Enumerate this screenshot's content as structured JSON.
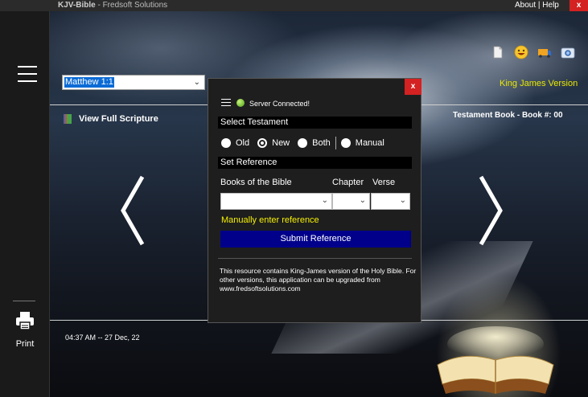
{
  "titlebar": {
    "app_name": "KJV-Bible",
    "app_sub": "- Fredsoft Solutions",
    "links": "About | Help",
    "close": "x"
  },
  "sidebar": {
    "menu_icon": "hamburger-icon",
    "print_icon": "printer-icon",
    "print_label": "Print"
  },
  "main": {
    "reference_value": "Matthew 1:1",
    "version_label": "King James Version",
    "view_full_label": "View Full Scripture",
    "testament_info": "Testament Book - Book #:  00",
    "datetime": "04:37 AM -- 27 Dec, 22",
    "icons": [
      "document-icon",
      "smiley-icon",
      "cart-icon",
      "camera-icon"
    ],
    "prev_icon": "chevron-left-icon",
    "next_icon": "chevron-right-icon"
  },
  "dialog": {
    "close": "x",
    "status": "Server Connected!",
    "select_testament": "Select Testament",
    "testaments": [
      {
        "label": "Old",
        "selected": false
      },
      {
        "label": "New",
        "selected": true
      },
      {
        "label": "Both",
        "selected": false
      },
      {
        "label": "Manual",
        "selected": false
      }
    ],
    "set_reference": "Set Reference",
    "books_label": "Books of the Bible",
    "chapter_label": "Chapter",
    "verse_label": "Verse",
    "book_value": "",
    "chapter_value": "",
    "verse_value": "",
    "manual_link": "Manually enter reference",
    "submit_label": "Submit Reference",
    "info_text": "This resource contains King-James version of the Holy Bible.  For other versions, this application can be upgraded from www.fredsoftsolutions.com"
  },
  "colors": {
    "accent_yellow": "#f5f000",
    "submit_blue": "#00008b",
    "close_red": "#d42121",
    "selection_blue": "#0b6bd6"
  }
}
